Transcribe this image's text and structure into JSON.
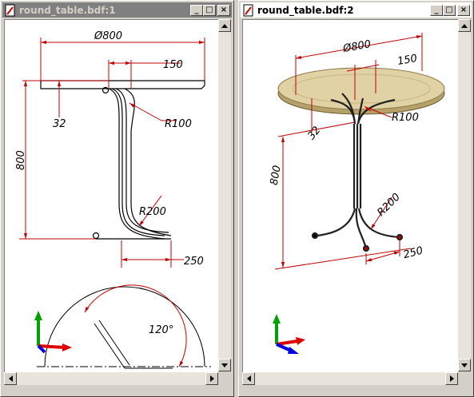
{
  "windows": [
    {
      "title": "round_table.bdf:1",
      "state": "inactive",
      "buttons": {
        "minimize": "_",
        "maximize": "□",
        "close": "×"
      },
      "drawing": {
        "dims": {
          "diameter": "Ø800",
          "offset": "150",
          "thickness": "32",
          "height": "800",
          "radius_top": "R100",
          "radius_bottom": "R200",
          "foot": "250",
          "angle": "120°"
        }
      }
    },
    {
      "title": "round_table.bdf:2",
      "state": "active",
      "buttons": {
        "minimize": "_",
        "maximize": "□",
        "close": "×"
      },
      "drawing": {
        "dims": {
          "diameter": "Ø800",
          "offset": "150",
          "thickness": "32",
          "height": "800",
          "radius_top": "R100",
          "radius_bottom": "R200",
          "foot": "250"
        }
      }
    }
  ],
  "colors": {
    "dimension": "#c00000",
    "tabletop": "#e0d2a4",
    "axis_x": "#e00000",
    "axis_y": "#00a000",
    "axis_z": "#0000e0",
    "inactive_title": "#808080",
    "active_title": "#ffffff"
  }
}
